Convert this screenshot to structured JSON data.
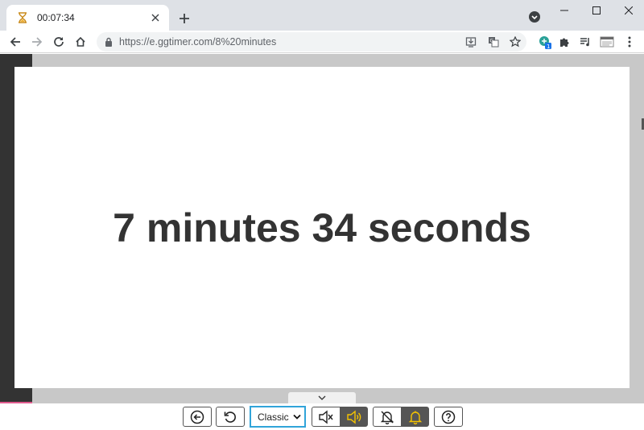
{
  "browser": {
    "tab": {
      "title": "00:07:34"
    },
    "omnibox": {
      "url": "https://e.ggtimer.com/8%20minutes"
    },
    "extension_badge": "1",
    "icons": [
      "back-icon",
      "forward-icon",
      "reload-icon",
      "home-icon",
      "lock-icon",
      "install-icon",
      "translate-icon",
      "bookmark-star-icon",
      "extension-icon",
      "puzzle-icon",
      "media-icon",
      "profile-icon",
      "menu-icon"
    ]
  },
  "timer": {
    "display": "7 minutes 34 seconds"
  },
  "controls": {
    "theme_select": {
      "value": "Classic",
      "options": [
        "Classic"
      ]
    },
    "sound": {
      "state": "on"
    },
    "alarm": {
      "state": "on"
    },
    "accent": "#f5c400"
  }
}
